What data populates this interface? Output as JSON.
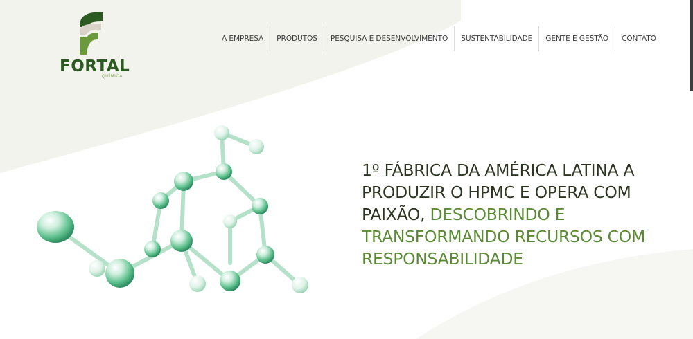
{
  "brand": {
    "name": "FORTAL",
    "subtitle": "QUÍMICA",
    "dark_green": "#2d5a22",
    "light_green": "#6a9a3c"
  },
  "nav": {
    "items": [
      {
        "label": "A EMPRESA"
      },
      {
        "label": "PRODUTOS"
      },
      {
        "label": "PESQUISA E DESENVOLVIMENTO"
      },
      {
        "label": "SUSTENTABILIDADE"
      },
      {
        "label": "GENTE E GESTÃO"
      },
      {
        "label": "CONTATO"
      }
    ]
  },
  "hero": {
    "headline_dark": "1º FÁBRICA DA AMÉRICA LATINA A PRODUZIR O HPMC E OPERA COM PAIXÃO,",
    "headline_green": "DESCOBRINDO E TRANSFORMANDO RECURSOS COM RESPONSABILIDADE",
    "image": "molecule-illustration"
  },
  "colors": {
    "text": "#2b3520",
    "accent": "#5a8a34",
    "background_shape": "#f3f3ee"
  }
}
